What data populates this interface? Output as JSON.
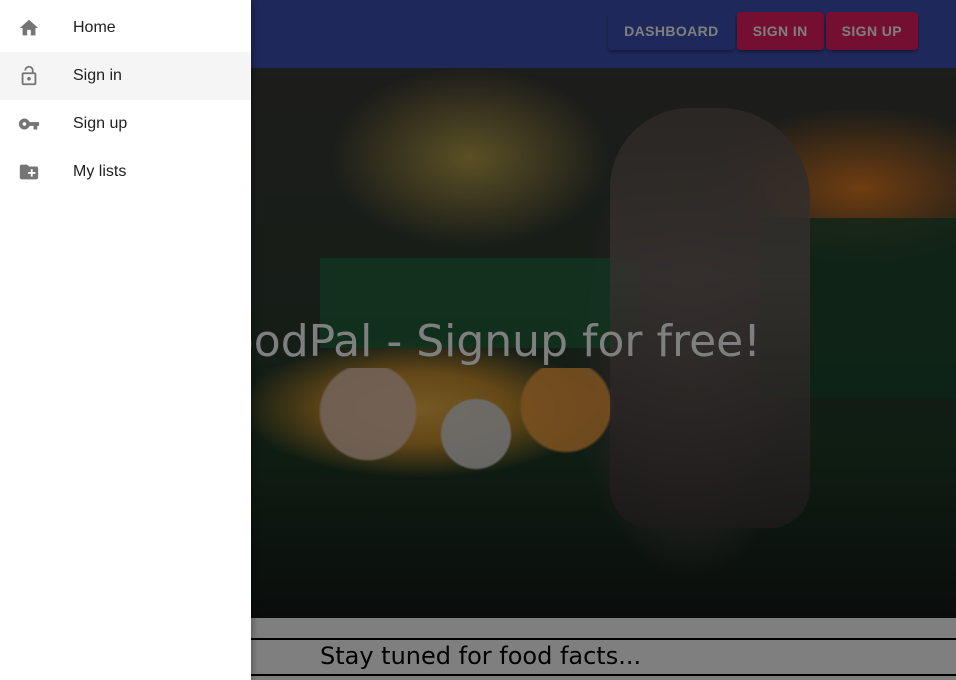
{
  "appbar": {
    "buttons": [
      {
        "label": "DASHBOARD"
      },
      {
        "label": "SIGN IN"
      },
      {
        "label": "SIGN UP"
      }
    ]
  },
  "hero": {
    "title": "FoodPal - Signup for free!"
  },
  "band": {
    "text": "Stay tuned for food facts..."
  },
  "drawer": {
    "items": [
      {
        "label": "Home",
        "icon": "home-icon"
      },
      {
        "label": "Sign in",
        "icon": "lock-open-icon"
      },
      {
        "label": "Sign up",
        "icon": "key-icon"
      },
      {
        "label": "My lists",
        "icon": "folder-add-icon"
      }
    ]
  },
  "colors": {
    "primary": "#3f51b5",
    "secondary": "#e91e63"
  }
}
